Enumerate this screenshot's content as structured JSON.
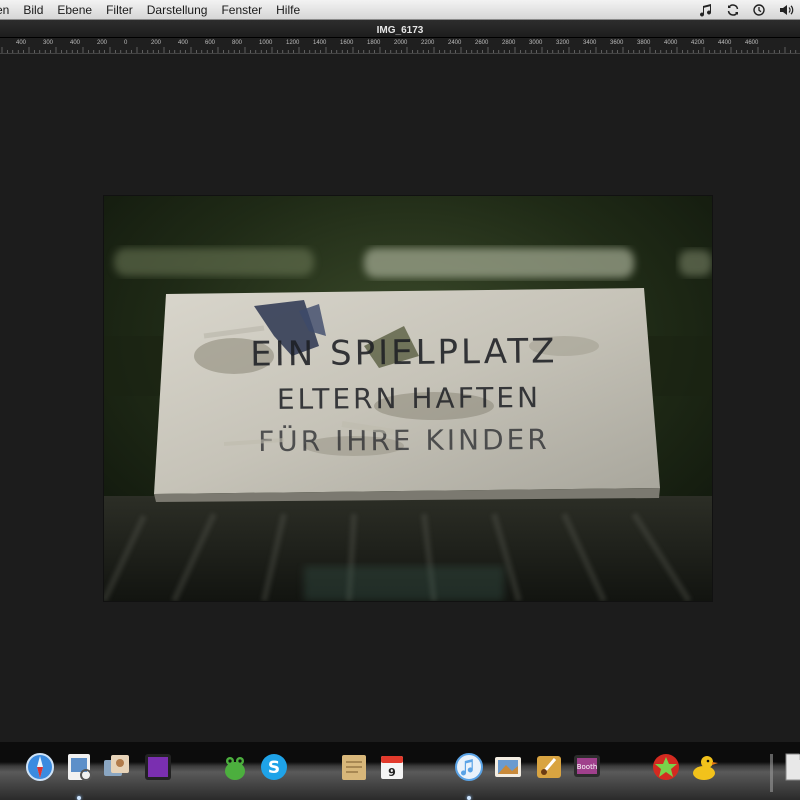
{
  "menubar": {
    "items": [
      "en",
      "Bild",
      "Ebene",
      "Filter",
      "Darstellung",
      "Fenster",
      "Hilfe"
    ],
    "status_icons": [
      "music-note-icon",
      "sync-icon",
      "time-machine-icon",
      "volume-icon"
    ]
  },
  "document": {
    "title": "IMG_6173"
  },
  "ruler": {
    "labels": [
      "400",
      "300",
      "400",
      "200",
      "0",
      "200",
      "400",
      "600",
      "800",
      "1000",
      "1200",
      "1400",
      "1600",
      "1800",
      "2000",
      "2200",
      "2400",
      "2600",
      "2800",
      "3000",
      "3200",
      "3400",
      "3600",
      "3800",
      "4000",
      "4200",
      "4400",
      "4600"
    ]
  },
  "photo": {
    "sign_lines": [
      "EIN SPIELPLATZ",
      "ELTERN HAFTEN",
      "FÜR IHRE KINDER"
    ]
  },
  "dock": {
    "icons": [
      {
        "name": "safari-icon",
        "color": "#3b8be0"
      },
      {
        "name": "preview-icon",
        "color": "#5c8fc9"
      },
      {
        "name": "photo-browser-icon",
        "color": "#8aa6c2"
      },
      {
        "name": "purple-app-icon",
        "color": "#7a2fb0"
      },
      {
        "name": "frog-app-icon",
        "color": "#4caf3e"
      },
      {
        "name": "skype-icon",
        "color": "#1fa3e8"
      },
      {
        "name": "notes-icon",
        "color": "#d8b77a"
      },
      {
        "name": "calendar-icon",
        "color": "#e23a2c"
      },
      {
        "name": "itunes-icon",
        "color": "#5aa3e6"
      },
      {
        "name": "iphoto-icon",
        "color": "#c98a3a"
      },
      {
        "name": "pixelmator-icon",
        "color": "#d9a441"
      },
      {
        "name": "photo-booth-icon",
        "color": "#a0408c"
      },
      {
        "name": "red-star-app-icon",
        "color": "#d42a20"
      },
      {
        "name": "cyberduck-icon",
        "color": "#f2c21b"
      },
      {
        "name": "document-icon",
        "color": "#e8e8e8"
      }
    ]
  }
}
